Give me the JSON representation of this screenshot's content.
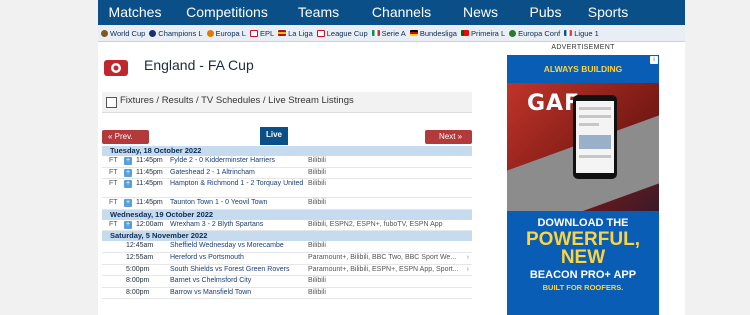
{
  "nav": [
    "Matches",
    "Competitions",
    "Teams",
    "Channels",
    "News",
    "Pubs",
    "Sports"
  ],
  "leagues": [
    {
      "label": "World Cup",
      "icon": "world-cup-icon",
      "color": "#7a5a1e"
    },
    {
      "label": "Champions L",
      "icon": "champions-league-icon",
      "color": "#1b2f6b"
    },
    {
      "label": "Europa L",
      "icon": "europa-league-icon",
      "color": "#e07b00"
    },
    {
      "label": "EPL",
      "icon": "england-flag-icon",
      "color": "#c8102e"
    },
    {
      "label": "La Liga",
      "icon": "spain-flag-icon",
      "color": "#f1bf00"
    },
    {
      "label": "League Cup",
      "icon": "england-flag-icon",
      "color": "#c8102e"
    },
    {
      "label": "Serie A",
      "icon": "italy-flag-icon",
      "color": "#009246"
    },
    {
      "label": "Bundesliga",
      "icon": "germany-flag-icon",
      "color": "#dd0000"
    },
    {
      "label": "Primeira L",
      "icon": "portugal-flag-icon",
      "color": "#006600"
    },
    {
      "label": "Europa Conf",
      "icon": "europa-conference-icon",
      "color": "#2b7a2b"
    },
    {
      "label": "Ligue 1",
      "icon": "france-flag-icon",
      "color": "#0055a4"
    }
  ],
  "page": {
    "title": "England - FA Cup",
    "subtitle": "Fixtures / Results / TV Schedules / Live Stream Listings"
  },
  "pager": {
    "prev": "« Prev.",
    "live": "Live",
    "next": "Next »"
  },
  "days": [
    {
      "date": "Tuesday, 18 October 2022",
      "matches": [
        {
          "status": "FT",
          "time": "11:45pm",
          "match": "Fylde 2 - 0 Kidderminster Harriers",
          "channels": "Bilibili"
        },
        {
          "status": "FT",
          "time": "11:45pm",
          "match": "Gateshead 2 - 1 Altrincham",
          "channels": "Bilibili"
        },
        {
          "status": "FT",
          "time": "11:45pm",
          "match": "Hampton & Richmond 1 - 2 Torquay United",
          "channels": "Bilibili"
        },
        {
          "status": "FT",
          "time": "11:45pm",
          "match": "Taunton Town 1 - 0 Yeovil Town",
          "channels": "Bilibili"
        }
      ]
    },
    {
      "date": "Wednesday, 19 October 2022",
      "matches": [
        {
          "status": "FT",
          "time": "12:00am",
          "match": "Wrexham 3 - 2 Blyth Spartans",
          "channels": "Bilibili, ESPN2, ESPN+, fuboTV, ESPN App"
        }
      ]
    },
    {
      "date": "Saturday, 5 November 2022",
      "matches": [
        {
          "status": "",
          "time": "12:45am",
          "match": "Sheffield Wednesday vs Morecambe",
          "channels": "Bilibili"
        },
        {
          "status": "",
          "time": "12:55am",
          "match": "Hereford vs Portsmouth",
          "channels": "Paramount+, Bilibili, BBC Two, BBC Sport We..."
        },
        {
          "status": "",
          "time": "5:00pm",
          "match": "South Shields vs Forest Green Rovers",
          "channels": "Paramount+, Bilibili, ESPN+, ESPN App, Sport..."
        },
        {
          "status": "",
          "time": "8:00pm",
          "match": "Barnet vs Chelmsford City",
          "channels": "Bilibili"
        },
        {
          "status": "",
          "time": "8:00pm",
          "match": "Barrow vs Mansfield Town",
          "channels": "Bilibili"
        }
      ]
    }
  ],
  "advert": {
    "label": "ADVERTISEMENT",
    "brand": "ALWAYS BUILDING",
    "logo": "GAF",
    "line1": "DOWNLOAD THE",
    "line2": "POWERFUL,",
    "line3": "NEW",
    "line4": "BEACON PRO+ APP",
    "line5": "BUILT FOR ROOFERS."
  },
  "colors": {
    "nav_bg": "#0a4f87",
    "date_bg": "#c7dbee",
    "pager_red": "#b23a3a",
    "accent": "#5aa0d8"
  }
}
